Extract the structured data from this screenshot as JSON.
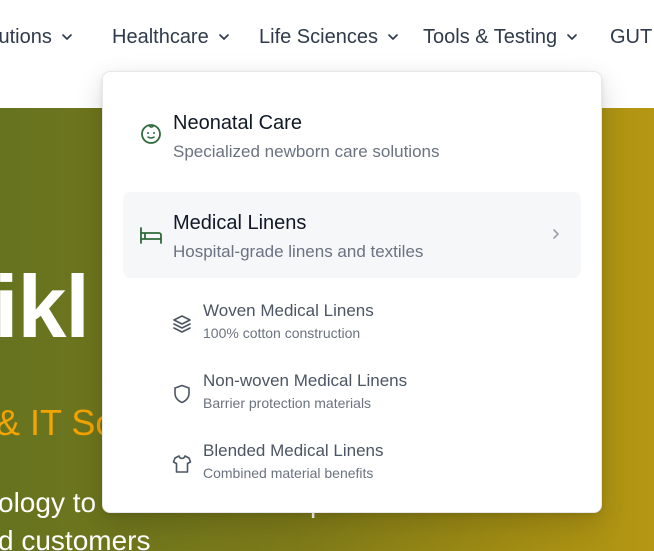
{
  "nav": {
    "items": [
      {
        "label": "lutions"
      },
      {
        "label": "Healthcare"
      },
      {
        "label": "Life Sciences"
      },
      {
        "label": "Tools & Testing"
      },
      {
        "label": "GUT"
      }
    ]
  },
  "hero": {
    "title": "ikl",
    "subtitle": "& IT So",
    "text_line1": "ology to",
    "text_line2": "d customers",
    "text_fragment": "p"
  },
  "dropdown": {
    "items": [
      {
        "title": "Neonatal Care",
        "desc": "Specialized newborn care solutions",
        "icon": "baby-face-icon"
      },
      {
        "title": "Medical Linens",
        "desc": "Hospital-grade linens and textiles",
        "icon": "bed-icon"
      }
    ],
    "subitems": [
      {
        "title": "Woven Medical Linens",
        "desc": "100% cotton construction",
        "icon": "layers-icon"
      },
      {
        "title": "Non-woven Medical Linens",
        "desc": "Barrier protection materials",
        "icon": "shield-icon"
      },
      {
        "title": "Blended Medical Linens",
        "desc": "Combined material benefits",
        "icon": "shirt-icon"
      }
    ]
  },
  "colors": {
    "accent": "#2f6a3b",
    "nav_text": "#2f3a4b",
    "hero_subtitle": "#f3a400"
  }
}
